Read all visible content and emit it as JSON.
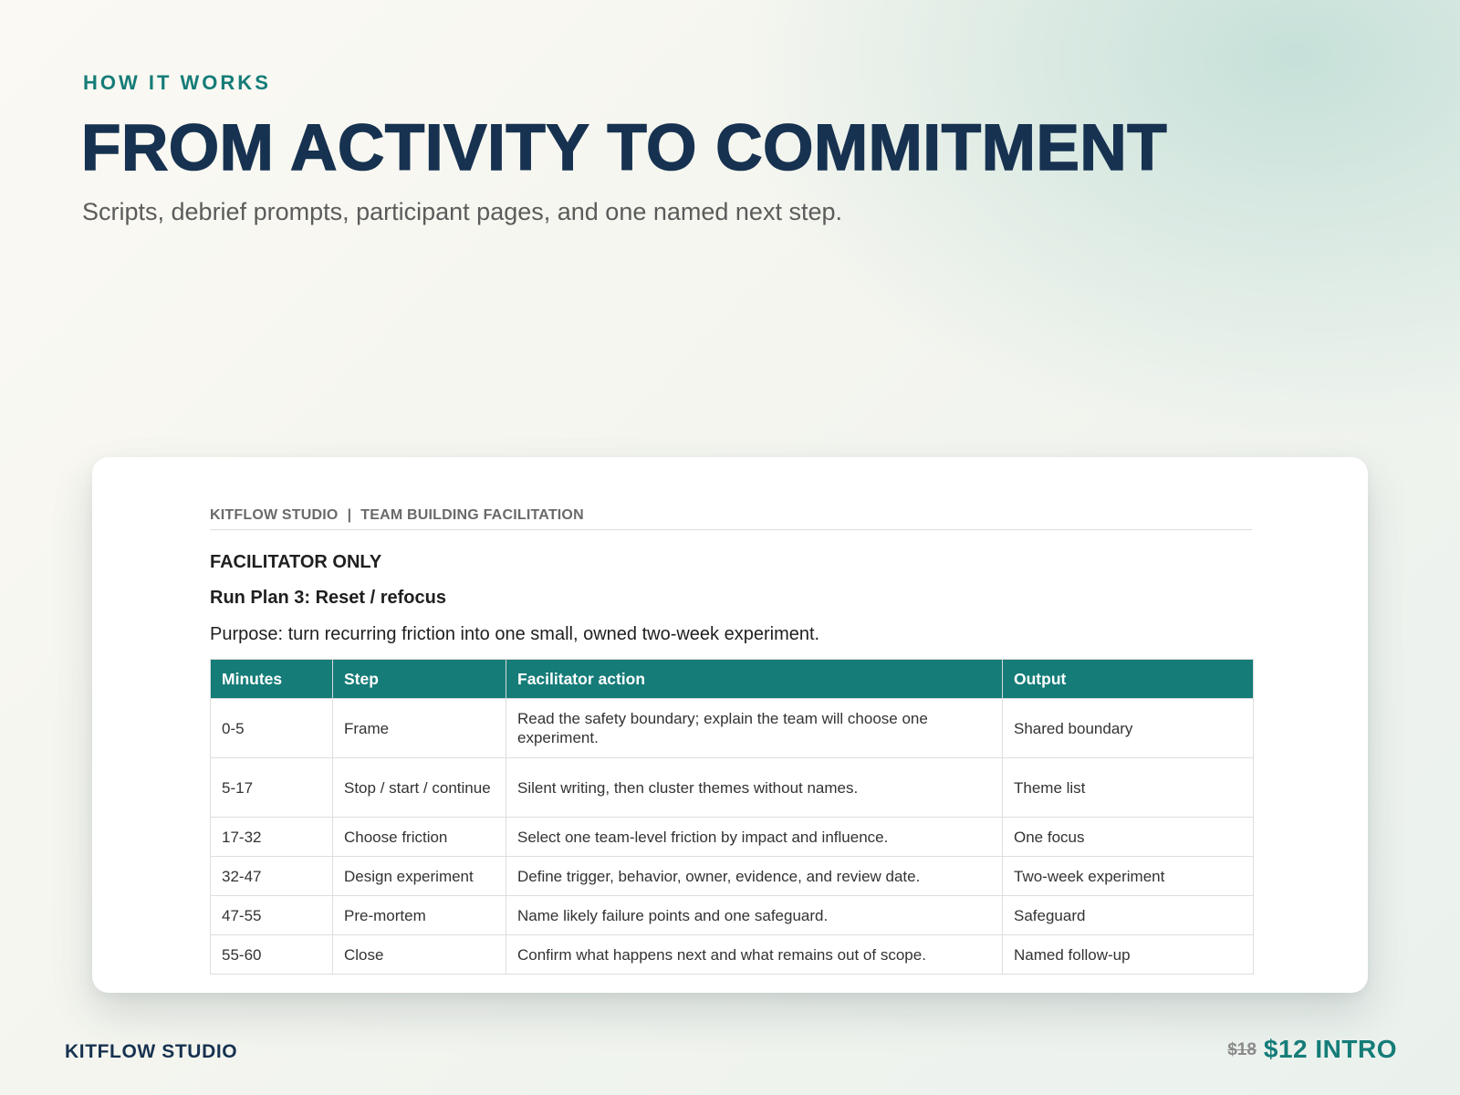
{
  "slide": {
    "eyebrow": "HOW IT WORKS",
    "headline": "FROM ACTIVITY TO COMMITMENT",
    "subhead": "Scripts, debrief prompts, participant pages, and one named next step."
  },
  "document": {
    "header_brand": "KITFLOW STUDIO",
    "header_separator": "|",
    "header_section": "TEAM BUILDING FACILITATION",
    "label": "FACILITATOR ONLY",
    "plan_title": "Run Plan 3: Reset / refocus",
    "purpose": "Purpose: turn recurring friction into one small, owned two-week experiment.",
    "table": {
      "columns": [
        "Minutes",
        "Step",
        "Facilitator action",
        "Output"
      ],
      "rows": [
        [
          "0-5",
          "Frame",
          "Read the safety boundary; explain the team will choose one experiment.",
          "Shared boundary"
        ],
        [
          "5-17",
          "Stop / start / continue",
          "Silent writing, then cluster themes without names.",
          "Theme list"
        ],
        [
          "17-32",
          "Choose friction",
          "Select one team-level friction by impact and influence.",
          "One focus"
        ],
        [
          "32-47",
          "Design experiment",
          "Define trigger, behavior, owner, evidence, and review date.",
          "Two-week experiment"
        ],
        [
          "47-55",
          "Pre-mortem",
          "Name likely failure points and one safeguard.",
          "Safeguard"
        ],
        [
          "55-60",
          "Close",
          "Confirm what happens next and what remains out of scope.",
          "Named follow-up"
        ]
      ]
    }
  },
  "footer": {
    "brand": "KITFLOW STUDIO",
    "old_price": "$18",
    "new_price": "$12 INTRO"
  },
  "colors": {
    "accent": "#157c78",
    "navy": "#173250"
  }
}
